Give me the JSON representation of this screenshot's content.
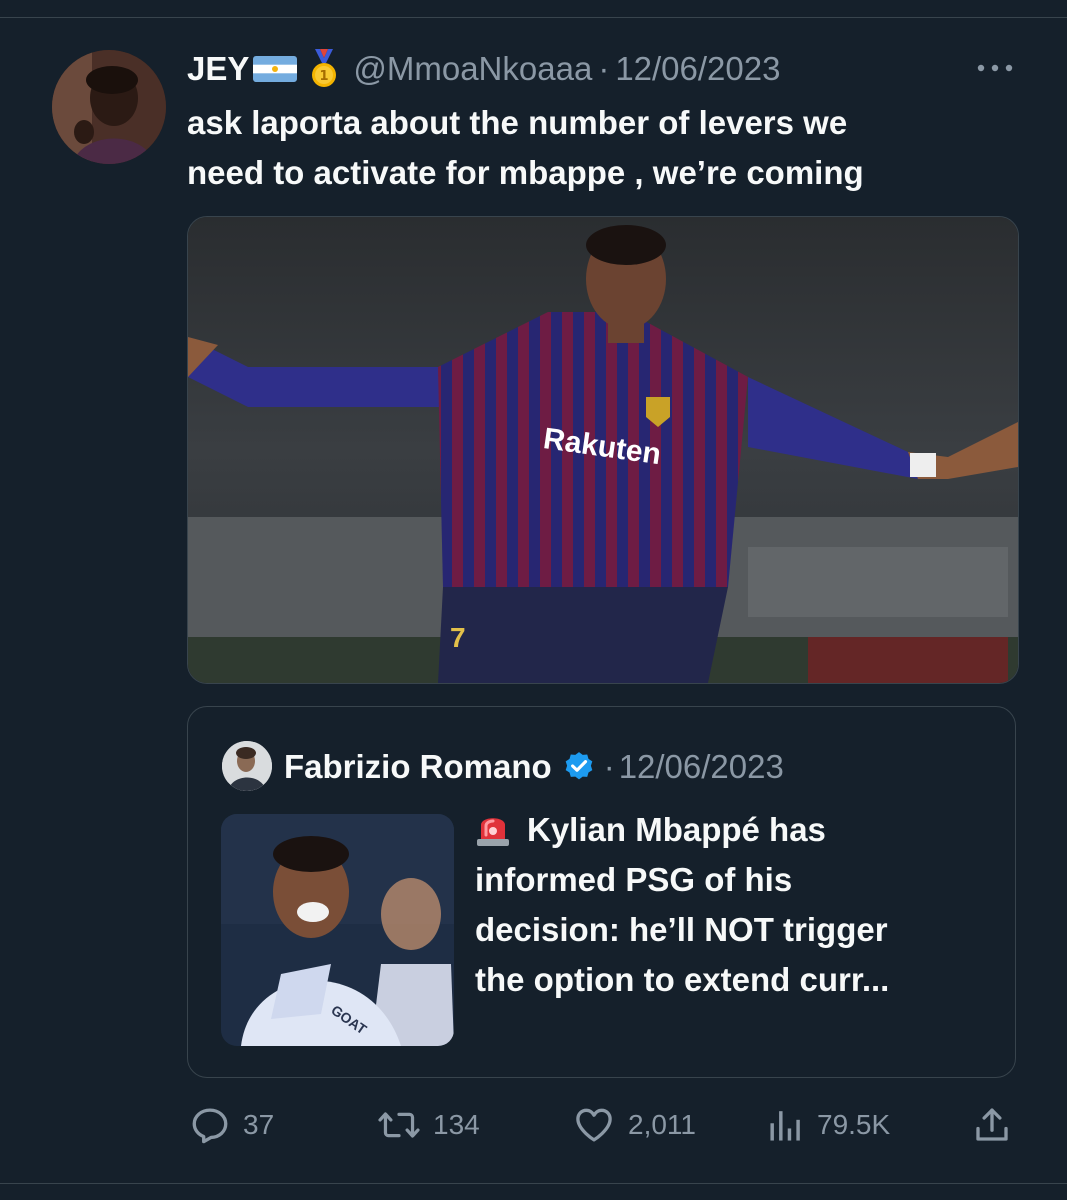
{
  "tweet": {
    "display_name": "JEY",
    "flag_icon": "argentina-flag-icon",
    "medal_icon": "gold-medal-icon",
    "handle": "@MmoaNkoaaa",
    "separator": "·",
    "date": "12/06/2023",
    "more_icon": "more-options-icon",
    "text_lines": [
      "ask laporta about the number of levers we",
      "need to activate for mbappe , we’re coming"
    ],
    "image_caption": {
      "shirt_sponsor": "Rakuten",
      "shirt_number": "7"
    }
  },
  "quote": {
    "display_name": "Fabrizio Romano",
    "verified_icon": "verified-badge-icon",
    "separator": "·",
    "date": "12/06/2023",
    "siren_icon": "rotating-light-icon",
    "text_lines": [
      "Kylian Mbappé has",
      "informed PSG of his",
      "decision: he’ll NOT trigger",
      "the option to extend curr..."
    ],
    "thumb_text": "GOAT"
  },
  "actions": {
    "reply": {
      "icon": "reply-icon",
      "count": "37"
    },
    "retweet": {
      "icon": "retweet-icon",
      "count": "134"
    },
    "like": {
      "icon": "like-icon",
      "count": "2,011"
    },
    "views": {
      "icon": "views-icon",
      "count": "79.5K"
    },
    "share": {
      "icon": "share-icon"
    }
  },
  "colors": {
    "background": "#15202b",
    "text": "#f7f9f9",
    "secondary_text": "#8b98a5",
    "border": "#38444d",
    "verified": "#1d9bf0"
  }
}
